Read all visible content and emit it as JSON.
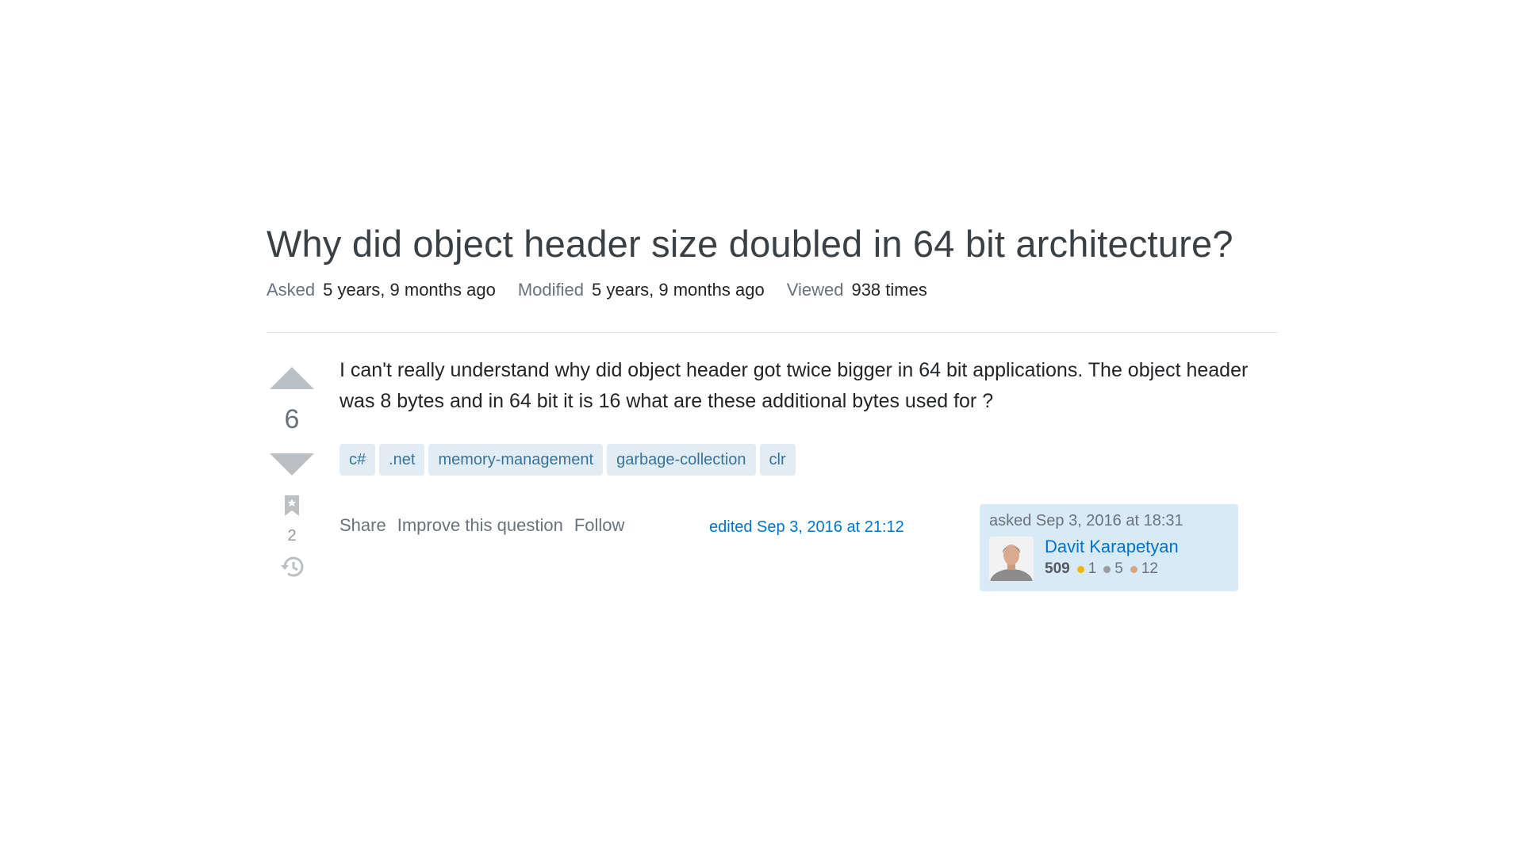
{
  "question": {
    "title": "Why did object header size doubled in 64 bit architecture?",
    "meta": {
      "asked_label": "Asked",
      "asked_value": "5 years, 9 months ago",
      "modified_label": "Modified",
      "modified_value": "5 years, 9 months ago",
      "viewed_label": "Viewed",
      "viewed_value": "938 times"
    },
    "votes": "6",
    "bookmarks": "2",
    "body": "I can't really understand why did object header got twice bigger in 64 bit applications. The object header was 8 bytes and in 64 bit it is 16 what are these additional bytes used for ?",
    "tags": [
      "c#",
      ".net",
      "memory-management",
      "garbage-collection",
      "clr"
    ],
    "actions": {
      "share": "Share",
      "improve": "Improve this question",
      "follow": "Follow"
    },
    "edited": "edited Sep 3, 2016 at 21:12",
    "owner": {
      "asked": "asked Sep 3, 2016 at 18:31",
      "name": "Davit Karapetyan",
      "reputation": "509",
      "gold": "1",
      "silver": "5",
      "bronze": "12"
    }
  },
  "colors": {
    "gold": "#f1b600",
    "silver": "#9a9ea2",
    "bronze": "#d1a684",
    "tag_bg": "#e1ecf4",
    "tag_text": "#39739d",
    "owner_card_bg": "#d9eaf7",
    "link": "#0074cc"
  }
}
